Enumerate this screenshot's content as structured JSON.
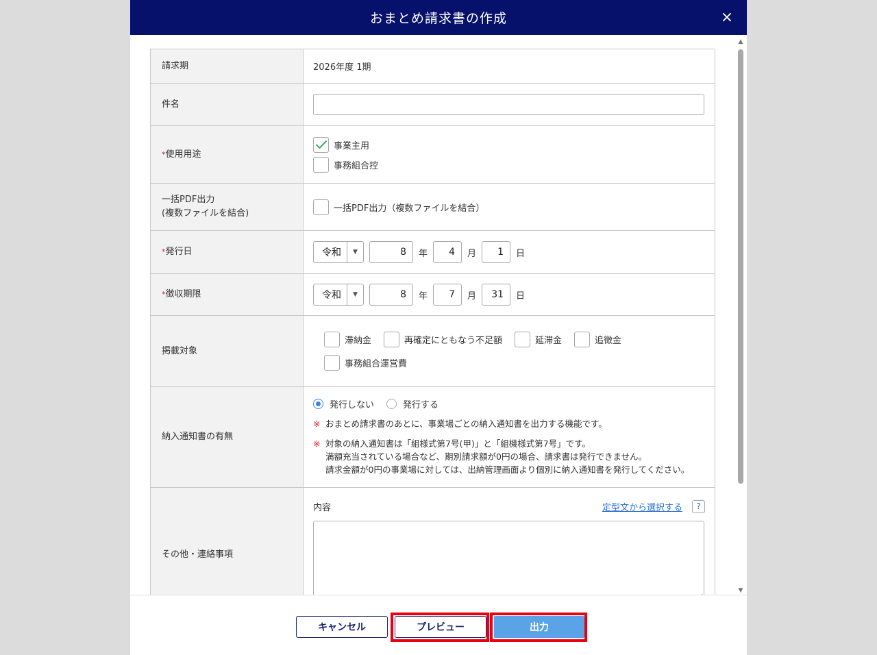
{
  "modal": {
    "title": "おまとめ請求書の作成",
    "close_glyph": "×"
  },
  "form": {
    "period": {
      "label": "請求期",
      "value": "2026年度 1期"
    },
    "subject": {
      "label": "件名",
      "value": ""
    },
    "usage": {
      "required_mark": "*",
      "label": "使用用途",
      "options": [
        {
          "label": "事業主用",
          "checked": true
        },
        {
          "label": "事務組合控",
          "checked": false
        }
      ]
    },
    "bulk_pdf": {
      "label_line1": "一括PDF出力",
      "label_line2": "(複数ファイルを結合)",
      "option_label": "一括PDF出力（複数ファイルを結合）",
      "checked": false
    },
    "issue_date": {
      "required_mark": "*",
      "label": "発行日",
      "era": "令和",
      "year": "8",
      "month": "4",
      "day": "1"
    },
    "due_date": {
      "required_mark": "*",
      "label": "徴収期限",
      "era": "令和",
      "year": "8",
      "month": "7",
      "day": "31"
    },
    "units": {
      "year": "年",
      "month": "月",
      "day": "日"
    },
    "targets": {
      "label": "掲載対象",
      "items": [
        {
          "label": "滞納金",
          "checked": false
        },
        {
          "label": "再確定にともなう不足額",
          "checked": false
        },
        {
          "label": "延滞金",
          "checked": false
        },
        {
          "label": "追徴金",
          "checked": false
        },
        {
          "label": "事務組合運営費",
          "checked": false
        }
      ]
    },
    "notice": {
      "label": "納入通知書の有無",
      "radio_no": "発行しない",
      "radio_yes": "発行する",
      "selected": "発行しない",
      "note_mark": "※",
      "note1": "おまとめ請求書のあとに、事業場ごとの納入通知書を出力する機能です。",
      "note2_line1": "対象の納入通知書は「組様式第7号(甲)」と「組機様式第7号」です。",
      "note2_line2": "満額充当されている場合など、期別請求額が0円の場合、請求書は発行できません。",
      "note2_line3": "請求金額が0円の事業場に対しては、出納管理画面より個別に納入通知書を発行してください。"
    },
    "memo": {
      "label": "その他・連絡事項",
      "content_label": "内容",
      "template_link": "定型文から選択する",
      "help_glyph": "?",
      "value": ""
    }
  },
  "footer": {
    "cancel_label": "キャンセル",
    "preview_label": "プレビュー",
    "output_label": "出力"
  },
  "colors": {
    "header_bg": "#06116b",
    "primary_button": "#5aa3e6",
    "highlight": "#e60012",
    "required": "#e02020",
    "link": "#2a6fd6"
  }
}
